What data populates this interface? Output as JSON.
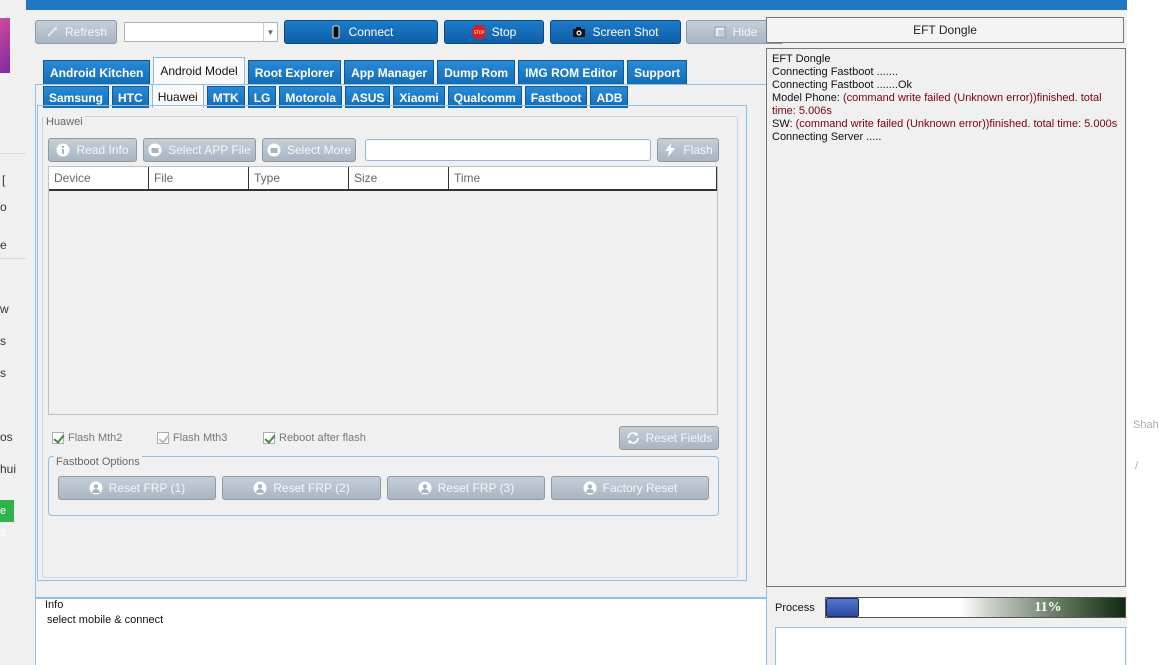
{
  "toolbar": {
    "refresh": "Refresh",
    "connect": "Connect",
    "stop": "Stop",
    "screenshot": "Screen Shot",
    "hide": "Hide",
    "port_value": ""
  },
  "main_tabs": [
    "Android Kitchen",
    "Android Model",
    "Root Explorer",
    "App Manager",
    "Dump Rom",
    "IMG ROM Editor",
    "Support"
  ],
  "main_tab_active": "Android Model",
  "brand_tabs": [
    "Samsung",
    "HTC",
    "Huawei",
    "MTK",
    "LG",
    "Motorola",
    "ASUS",
    "Xiaomi",
    "Qualcomm",
    "Fastboot",
    "ADB"
  ],
  "brand_tab_active": "Huawei",
  "huawei": {
    "group_title": "Huawei",
    "read_info": "Read Info",
    "select_app": "Select APP File",
    "select_more": "Select More",
    "file_path": "",
    "flash": "Flash",
    "columns": [
      "Device",
      "File",
      "Type",
      "Size",
      "Time"
    ],
    "options": [
      {
        "label": "Flash Mth2",
        "checked": true
      },
      {
        "label": "Flash Mth3",
        "checked": true
      },
      {
        "label": "Reboot after flash",
        "checked": true
      }
    ],
    "reset_fields": "Reset Fields",
    "fastboot_title": "Fastboot Options",
    "fastboot_buttons": [
      "Reset FRP (1)",
      "Reset FRP  (2)",
      "Reset FRP (3)",
      "Factory Reset"
    ]
  },
  "right": {
    "title": "EFT Dongle",
    "log": [
      {
        "text": "EFT Dongle",
        "detail": ""
      },
      {
        "text": "Connecting Fastboot .......",
        "detail": ""
      },
      {
        "text": "Connecting Fastboot .......Ok",
        "detail": ""
      },
      {
        "text": "Model Phone: ",
        "detail": "(command write failed (Unknown error))finished. total time: 5.006s"
      },
      {
        "text": "SW: ",
        "detail": "(command write failed (Unknown error))finished. total time: 5.000s"
      },
      {
        "text": "Connecting Server .....",
        "detail": ""
      }
    ]
  },
  "info": {
    "title": "Info",
    "message": "select mobile & connect"
  },
  "process": {
    "label": "Process",
    "percent_text": "11%",
    "value": 0.11
  },
  "background_fragments": [
    "[",
    "o",
    "e",
    "w",
    "s",
    "s",
    "os",
    "hui",
    "e a",
    "Shah",
    "/"
  ],
  "colors": {
    "accent": "#1f78c1",
    "error_text": "#7a0010",
    "button_gray": "#b4bfcb"
  }
}
